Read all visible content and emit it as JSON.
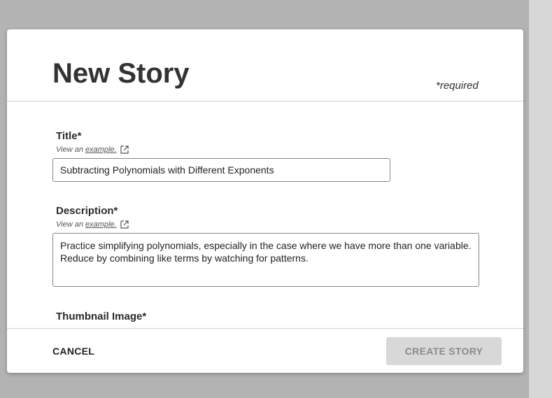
{
  "modal": {
    "title": "New Story",
    "required_note": "*required"
  },
  "fields": {
    "title": {
      "label": "Title*",
      "example_prefix": "View an",
      "example_link": "example.",
      "value": "Subtracting Polynomials with Different Exponents"
    },
    "description": {
      "label": "Description*",
      "example_prefix": "View an",
      "example_link": "example.",
      "value": "Practice simplifying polynomials, especially in the case where we have more than one variable. Reduce by combining like terms by watching for patterns."
    },
    "thumbnail": {
      "label": "Thumbnail Image*"
    }
  },
  "footer": {
    "cancel_label": "CANCEL",
    "create_label": "CREATE STORY"
  },
  "icons": {
    "external_link": "external-link-icon"
  },
  "colors": {
    "overlay": "#b3b3b3",
    "disabled_button": "#d8d8d8",
    "disabled_text": "#8a8a8a"
  }
}
